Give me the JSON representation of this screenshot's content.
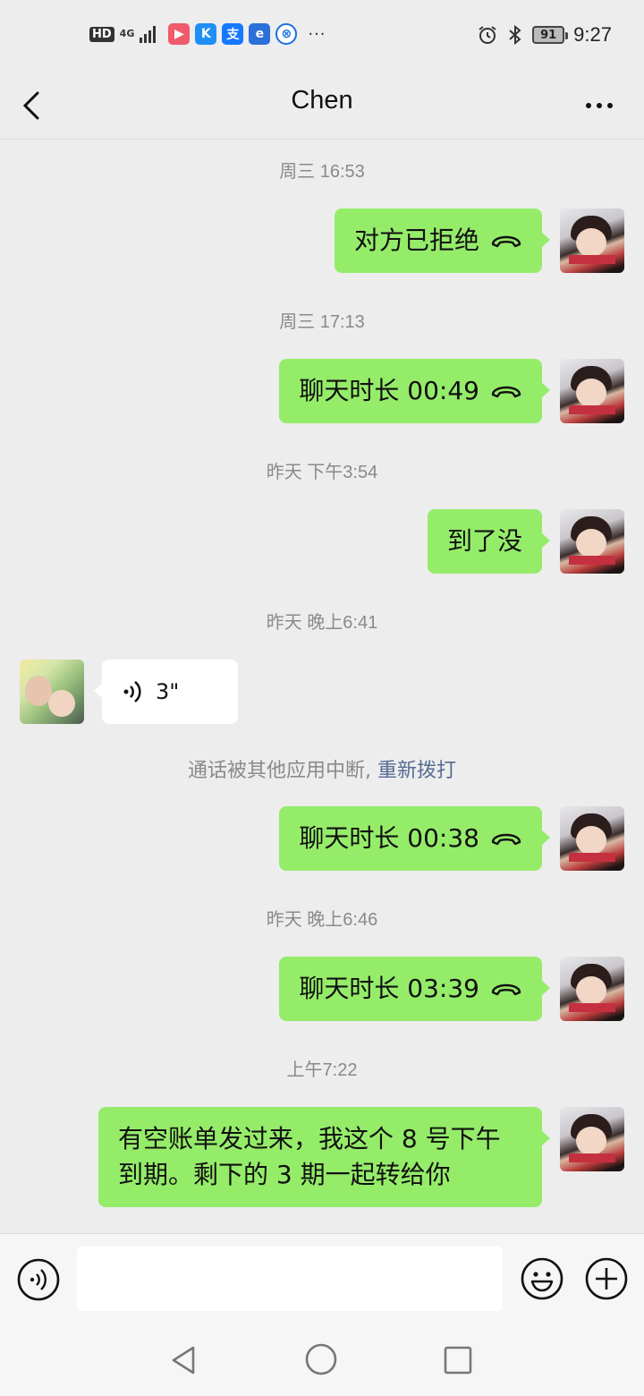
{
  "status_bar": {
    "hd": "HD",
    "network": "4G",
    "apps": [
      "bilibili-app-icon",
      "kugou-app-icon",
      "alipay-app-icon",
      "people-app-icon",
      "browser-app-icon"
    ],
    "alipay_glyph": "支",
    "kugou_glyph": "K",
    "more": "···",
    "battery": "91",
    "time": "9:27"
  },
  "header": {
    "title": "Chen"
  },
  "messages": [
    {
      "type": "timestamp",
      "text": "周三 16:53"
    },
    {
      "type": "call",
      "sender": "me",
      "text": "对方已拒绝"
    },
    {
      "type": "timestamp",
      "text": "周三 17:13"
    },
    {
      "type": "call",
      "sender": "me",
      "text": "聊天时长 00:49"
    },
    {
      "type": "timestamp",
      "text": "昨天 下午3:54"
    },
    {
      "type": "text",
      "sender": "me",
      "text": "到了没"
    },
    {
      "type": "timestamp",
      "text": "昨天 晚上6:41"
    },
    {
      "type": "voice",
      "sender": "them",
      "text": "3\""
    },
    {
      "type": "system",
      "text": "通话被其他应用中断,",
      "link": " 重新拨打"
    },
    {
      "type": "call",
      "sender": "me",
      "text": "聊天时长 00:38"
    },
    {
      "type": "timestamp",
      "text": "昨天 晚上6:46"
    },
    {
      "type": "call",
      "sender": "me",
      "text": "聊天时长 03:39"
    },
    {
      "type": "timestamp",
      "text": "上午7:22"
    },
    {
      "type": "text",
      "sender": "me",
      "lines": [
        "有空账单发过来，我这个 8 号下午",
        "到期。剩下的 3 期一起转给你"
      ]
    }
  ],
  "input_bar": {
    "placeholder": ""
  },
  "colors": {
    "me_bubble": "#95ec69",
    "them_bubble": "#ffffff",
    "background": "#ededed",
    "link": "#576b95"
  }
}
